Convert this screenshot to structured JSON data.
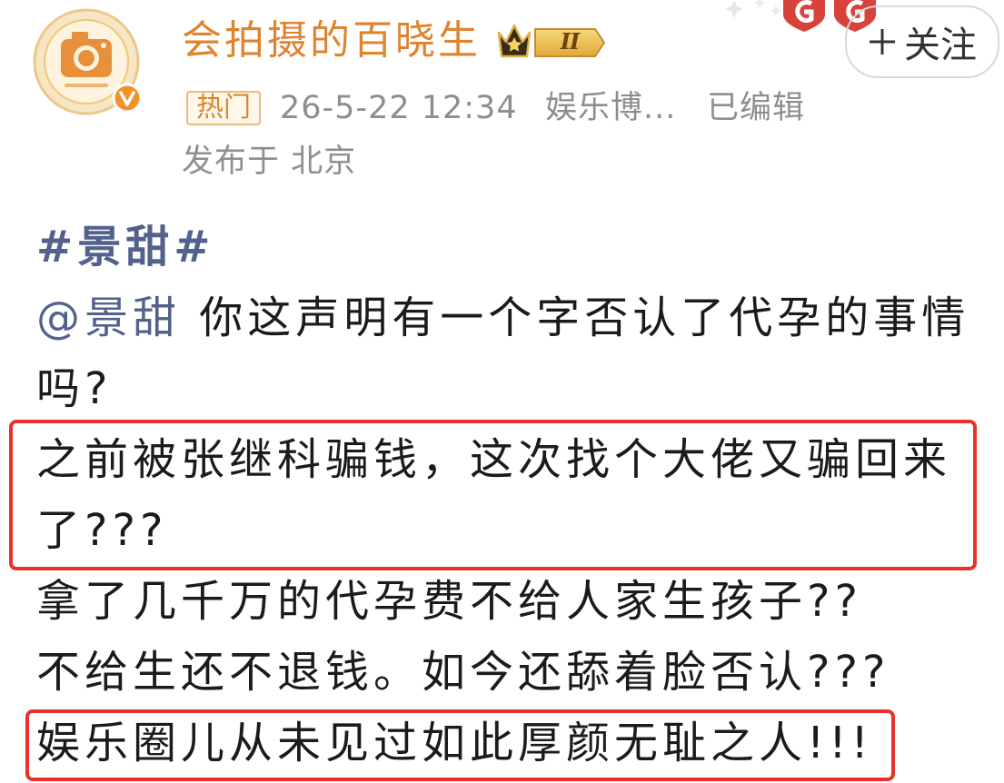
{
  "colors": {
    "username": "#e0832f",
    "link": "#52628c",
    "text": "#1b1b1b",
    "meta": "#8e8e8e",
    "highlight_box": "#e8322c",
    "hot_tag_border": "#e9bb7d",
    "hot_tag_text": "#d98532",
    "verified": "#f0922c"
  },
  "icons": {
    "avatar": "camera-logo-avatar",
    "verified": "verified-v-icon",
    "level": "crown-icon",
    "follow": "plus-icon",
    "medals": "medal-icon",
    "decor": "sparkle-icon"
  },
  "header": {
    "username": "会拍摄的百晓生",
    "level_label": "II",
    "follow_label": "关注"
  },
  "meta": {
    "hot_tag": "热门",
    "timestamp": "26-5-22 12:34",
    "source": "娱乐博...",
    "edited": "已编辑",
    "location": "发布于 北京"
  },
  "post": {
    "hashtag": "#景甜#",
    "mention": "@景甜",
    "lines": [
      "你这声明有一个字否认了代孕的事情",
      "吗?",
      "之前被张继科骗钱，这次找个大佬又骗回来",
      "了???",
      "拿了几千万的代孕费不给人家生孩子??",
      "不给生还不退钱。如今还舔着脸否认???",
      "娱乐圈儿从未见过如此厚颜无耻之人!!!"
    ]
  }
}
